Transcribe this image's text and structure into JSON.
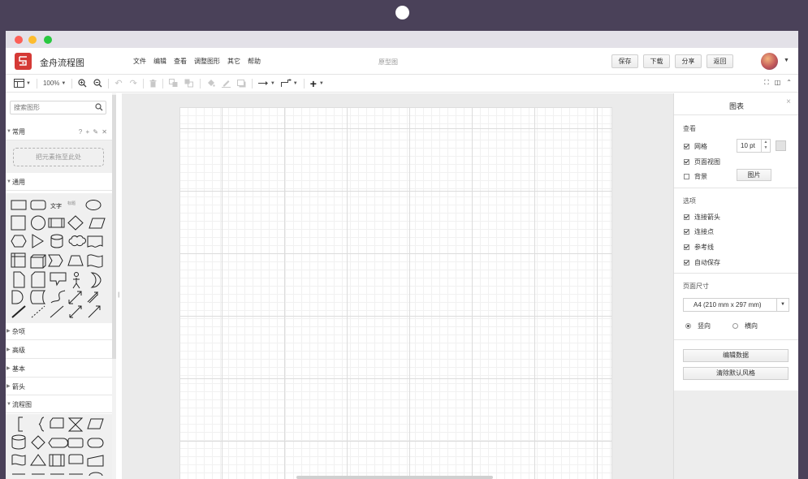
{
  "app": {
    "name": "金舟流程图",
    "document_title": "原型图"
  },
  "menus": [
    "文件",
    "编辑",
    "查看",
    "调整图形",
    "其它",
    "帮助"
  ],
  "actions": [
    "保存",
    "下载",
    "分享",
    "返回"
  ],
  "toolbar": {
    "zoom": "100%"
  },
  "sidebar": {
    "search_placeholder": "搜索图形",
    "sections": {
      "common": "常用",
      "general": "通用",
      "misc": "杂项",
      "advanced": "高级",
      "basic": "基本",
      "arrows": "箭头",
      "flowchart": "流程图"
    },
    "common_tools": "? + ✎ ✕",
    "scratch_hint": "把元素拖至此处",
    "general_text_shape": "文字",
    "general_heading_shape": "标题"
  },
  "panel": {
    "title": "图表",
    "view": {
      "title": "查看",
      "grid_label": "网格",
      "grid_size": "10 pt",
      "page_view_label": "页面视图",
      "background_label": "背景",
      "image_button": "图片"
    },
    "options": {
      "title": "选项",
      "items": [
        "连接箭头",
        "连接点",
        "参考线",
        "自动保存"
      ]
    },
    "page_size": {
      "title": "页面尺寸",
      "selected": "A4 (210 mm x 297 mm)",
      "portrait": "竖向",
      "landscape": "横向"
    },
    "buttons": {
      "edit_data": "编辑数据",
      "clear_style": "清除默认风格"
    }
  }
}
